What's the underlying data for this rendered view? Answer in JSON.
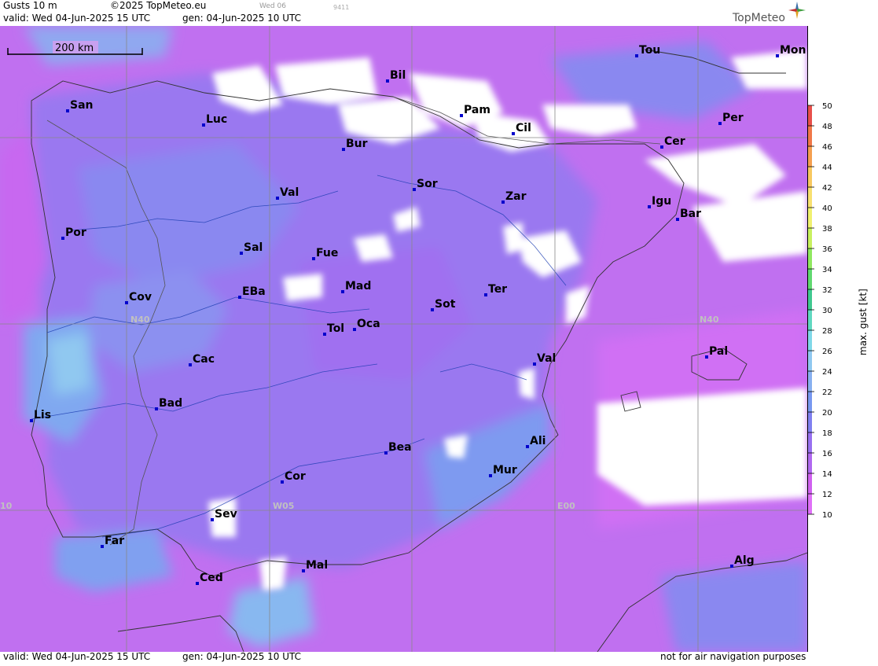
{
  "header": {
    "product": "Gusts 10 m",
    "copyright": "©2025 TopMeteo.eu",
    "valid": "valid:  Wed  04-Jun-2025  15 UTC",
    "gen": "gen: 04-Jun-2025 10 UTC",
    "day": "Wed 06",
    "code": "9411",
    "brand": "TopMeteo"
  },
  "footer": {
    "valid": "valid:  Wed  04-Jun-2025  15 UTC",
    "gen": "gen: 04-Jun-2025 10 UTC",
    "disclaimer": "not for air navigation purposes"
  },
  "scale_bar": "200 km",
  "grid_labels": {
    "lat40": "N40",
    "lat40_east": "N40",
    "lon05": "W05",
    "lon00": "E00",
    "lon10": "10"
  },
  "cities": [
    {
      "name": "San"
    },
    {
      "name": "Luc"
    },
    {
      "name": "Bil"
    },
    {
      "name": "Pam"
    },
    {
      "name": "Cil"
    },
    {
      "name": "Tou"
    },
    {
      "name": "Mon"
    },
    {
      "name": "Per"
    },
    {
      "name": "Cer"
    },
    {
      "name": "Bur"
    },
    {
      "name": "Val"
    },
    {
      "name": "Sor"
    },
    {
      "name": "Zar"
    },
    {
      "name": "Igu"
    },
    {
      "name": "Bar"
    },
    {
      "name": "Por"
    },
    {
      "name": "Sal"
    },
    {
      "name": "Fue"
    },
    {
      "name": "EBa"
    },
    {
      "name": "Mad"
    },
    {
      "name": "Cov"
    },
    {
      "name": "Ter"
    },
    {
      "name": "Sot"
    },
    {
      "name": "Tol"
    },
    {
      "name": "Oca"
    },
    {
      "name": "Val"
    },
    {
      "name": "Pal"
    },
    {
      "name": "Cac"
    },
    {
      "name": "Bad"
    },
    {
      "name": "Lis"
    },
    {
      "name": "Bea"
    },
    {
      "name": "Ali"
    },
    {
      "name": "Mur"
    },
    {
      "name": "Cor"
    },
    {
      "name": "Sev"
    },
    {
      "name": "Far"
    },
    {
      "name": "Mal"
    },
    {
      "name": "Ced"
    },
    {
      "name": "Alg"
    }
  ],
  "legend": {
    "title": "max. gust  [kt]",
    "ticks": [
      50,
      48,
      46,
      44,
      42,
      40,
      38,
      36,
      34,
      32,
      30,
      28,
      26,
      24,
      22,
      20,
      18,
      16,
      14,
      12,
      10
    ],
    "colors": [
      "#e8504a",
      "#f07848",
      "#f5a050",
      "#f8c860",
      "#f8e070",
      "#f0f070",
      "#c8f060",
      "#90e860",
      "#60d870",
      "#40c890",
      "#60d8c0",
      "#80d8e8",
      "#90c8f0",
      "#88b0f0",
      "#7898f0",
      "#8080f0",
      "#9870f0",
      "#b068f0",
      "#d060f0",
      "#e070f8"
    ]
  }
}
